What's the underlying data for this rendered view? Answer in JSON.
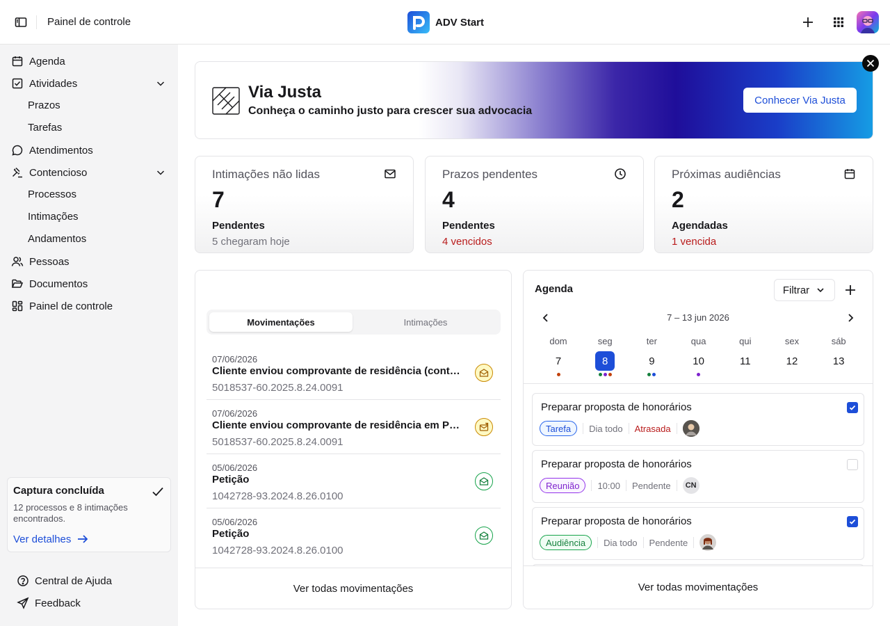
{
  "topbar": {
    "title": "Painel de controle",
    "brand": "ADV Start",
    "user_initials": ""
  },
  "sidebar": {
    "items": [
      {
        "label": "Agenda",
        "icon": "calendar-icon"
      },
      {
        "label": "Atividades",
        "icon": "checkbox-icon",
        "children": [
          "Prazos",
          "Tarefas"
        ]
      },
      {
        "label": "Atendimentos",
        "icon": "chat-bubble-icon"
      },
      {
        "label": "Contencioso",
        "icon": "gavel-icon",
        "children": [
          "Processos",
          "Intimações",
          "Andamentos"
        ]
      },
      {
        "label": "Pessoas",
        "icon": "users-icon"
      },
      {
        "label": "Documentos",
        "icon": "folder-open-icon"
      },
      {
        "label": "Painel de controle",
        "icon": "dashboard-icon"
      }
    ],
    "capture": {
      "title": "Captura concluída",
      "description": "12 processos e 8 intimações encontrados.",
      "link": "Ver detalhes"
    },
    "footer": [
      {
        "label": "Central de Ajuda",
        "icon": "help-circle-icon"
      },
      {
        "label": "Feedback",
        "icon": "send-icon"
      }
    ]
  },
  "banner": {
    "title": "Via Justa",
    "subtitle": "Conheça o caminho justo para crescer sua advocacia",
    "button": "Conhecer Via Justa"
  },
  "stats": [
    {
      "label": "Intimações não lidas",
      "value": "7",
      "caption": "Pendentes",
      "sub": "5 chegaram hoje",
      "icon": "mail-icon"
    },
    {
      "label": "Prazos pendentes",
      "value": "4",
      "caption": "Pendentes",
      "sub": "4 vencidos",
      "icon": "clock-icon"
    },
    {
      "label": "Próximas audiências",
      "value": "2",
      "caption": "Agendadas",
      "sub": "1 vencida",
      "icon": "calendar-icon"
    }
  ],
  "movements": {
    "tabs": [
      "Movimentações",
      "Intimações"
    ],
    "active_tab": 0,
    "items": [
      {
        "date": "07/06/2026",
        "title": "Cliente enviou comprovante de residência (conta de luz) e documento de identidade",
        "number": "5018537-60.2025.8.24.0091",
        "status": "yellow"
      },
      {
        "date": "07/06/2026",
        "title": "Cliente enviou comprovante de residência em PDF e cópia do RG",
        "number": "5018537-60.2025.8.24.0091",
        "status": "yellow"
      },
      {
        "date": "05/06/2026",
        "title": "Petição",
        "number": "1042728-93.2024.8.26.0100",
        "status": "green"
      },
      {
        "date": "05/06/2026",
        "title": "Petição",
        "number": "1042728-93.2024.8.26.0100",
        "status": "green"
      }
    ],
    "footer": "Ver todas movimentações"
  },
  "agenda": {
    "title": "Agenda",
    "filter": "Filtrar",
    "range": "7 – 13 jun 2026",
    "days": [
      {
        "name": "dom",
        "num": "7",
        "dots": [
          "#c2410c"
        ]
      },
      {
        "name": "seg",
        "num": "8",
        "dots": [
          "#15803d",
          "#7e22ce",
          "#c2410c"
        ],
        "selected": true
      },
      {
        "name": "ter",
        "num": "9",
        "dots": [
          "#15803d",
          "#1d4ed8"
        ]
      },
      {
        "name": "qua",
        "num": "10",
        "dots": [
          "#7e22ce"
        ]
      },
      {
        "name": "qui",
        "num": "11",
        "dots": []
      },
      {
        "name": "sex",
        "num": "12",
        "dots": []
      },
      {
        "name": "sáb",
        "num": "13",
        "dots": []
      }
    ],
    "events": [
      {
        "title": "Preparar proposta de honorários",
        "tag": "Tarefa",
        "tag_color": "blue",
        "time": "Dia todo",
        "status": "Atrasada",
        "late": true,
        "checked": true,
        "avatar": ""
      },
      {
        "title": "Preparar proposta de honorários",
        "tag": "Reunião",
        "tag_color": "purple",
        "time": "10:00",
        "status": "Pendente",
        "late": false,
        "checked": false,
        "avatar": "CN"
      },
      {
        "title": "Preparar proposta de honorários",
        "tag": "Audiência",
        "tag_color": "green",
        "time": "Dia todo",
        "status": "Pendente",
        "late": false,
        "checked": true,
        "avatar": ""
      }
    ],
    "footer": "Ver todas movimentações"
  },
  "colors": {
    "accent": "#1d4ed8",
    "danger": "#b91c1c",
    "sidebar_bg": "#f4f4f5"
  }
}
